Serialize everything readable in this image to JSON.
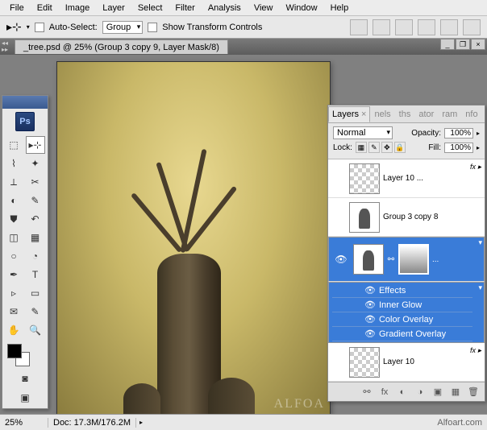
{
  "menu": {
    "items": [
      "File",
      "Edit",
      "Image",
      "Layer",
      "Select",
      "Filter",
      "Analysis",
      "View",
      "Window",
      "Help"
    ]
  },
  "options": {
    "auto_select_label": "Auto-Select:",
    "auto_select_value": "Group",
    "show_transform_label": "Show Transform Controls"
  },
  "document": {
    "tab_title": "_tree.psd @ 25% (Group 3 copy 9, Layer Mask/8)",
    "watermark": "ALFOA"
  },
  "status": {
    "zoom": "25%",
    "doc": "Doc: 17.3M/176.2M",
    "url": "Alfoart.com"
  },
  "layers_panel": {
    "tabs": [
      "Layers",
      "nels",
      "ths",
      "ator",
      "ram",
      "nfo"
    ],
    "blend_mode": "Normal",
    "opacity_label": "Opacity:",
    "opacity_value": "100%",
    "lock_label": "Lock:",
    "fill_label": "Fill:",
    "fill_value": "100%",
    "layers": [
      {
        "name": "Layer 10 ...",
        "thumb": "checker",
        "fx": true
      },
      {
        "name": "Group 3 copy 8",
        "thumb": "tree"
      },
      {
        "name": "",
        "thumb": "tree",
        "mask": true,
        "selected": true,
        "fx": true,
        "ellipsis": "..."
      },
      {
        "name": "Layer 10",
        "thumb": "checker",
        "fx": true
      }
    ],
    "effects_label": "Effects",
    "effects": [
      "Inner Glow",
      "Color Overlay",
      "Gradient Overlay"
    ]
  }
}
